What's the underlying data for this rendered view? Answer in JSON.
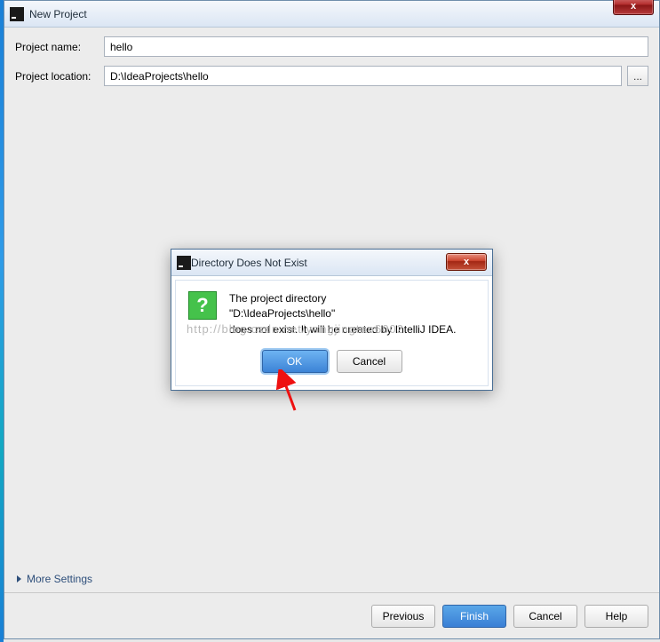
{
  "window": {
    "title": "New Project",
    "close_x": "x"
  },
  "fields": {
    "name_label": "Project name:",
    "name_value": "hello",
    "location_label": "Project location:",
    "location_value": "D:\\IdeaProjects\\hello",
    "browse_label": "..."
  },
  "more_settings": "More Settings",
  "footer": {
    "previous": "Previous",
    "finish": "Finish",
    "cancel": "Cancel",
    "help": "Help"
  },
  "modal": {
    "title": "Directory Does Not Exist",
    "close_x": "x",
    "line1": "The project directory",
    "line2": "\"D:\\IdeaProjects\\hello\"",
    "line3": "does not exist. It will be created by IntelliJ IDEA.",
    "ok": "OK",
    "cancel": "Cancel",
    "question_mark": "?"
  },
  "watermark": "http://blog.csdn.net/yangjingtao6002"
}
